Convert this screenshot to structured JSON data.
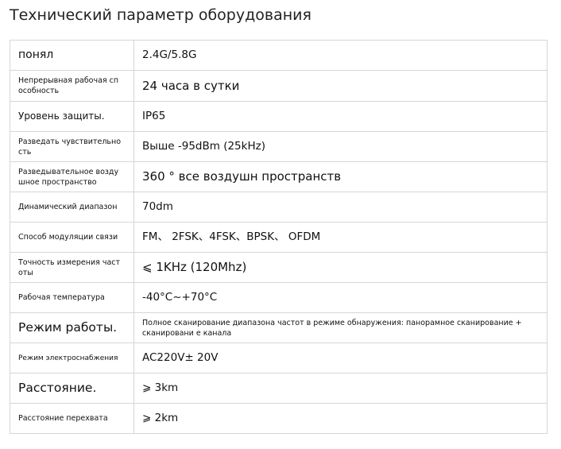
{
  "title": "Технический параметр оборудования",
  "rows": [
    {
      "key": "понял",
      "value": "2.4G/5.8G"
    },
    {
      "key": "Непрерывная рабочая сп особность",
      "value": "24 часа в сутки"
    },
    {
      "key": "Уровень защиты.",
      "value": "IP65"
    },
    {
      "key": "Разведать чувствительно сть",
      "value": "Выше -95dBm (25kHz)"
    },
    {
      "key": "Разведывательное возду шное пространство",
      "value": "360 ° все воздушн пространств"
    },
    {
      "key": "Динамический диапазон",
      "value": "70dm"
    },
    {
      "key": "Способ модуляции связи",
      "value": "FM、 2FSK、4FSK、BPSK、 OFDM"
    },
    {
      "key": "Точность измерения част оты",
      "value": "⩽ 1KHz (120Mhz)"
    },
    {
      "key": "Рабочая температура",
      "value": "-40°C~+70°C"
    },
    {
      "key": "Режим работы.",
      "value": "Полное сканирование диапазона частот в режиме обнаружения: панорамное сканирование + сканировани е канала"
    },
    {
      "key": "Режим электроснабжения",
      "value": "AC220V± 20V"
    },
    {
      "key": "Расстояние.",
      "value": "⩾ 3km"
    },
    {
      "key": "Расстояние перехвата",
      "value": "⩾ 2km"
    }
  ]
}
